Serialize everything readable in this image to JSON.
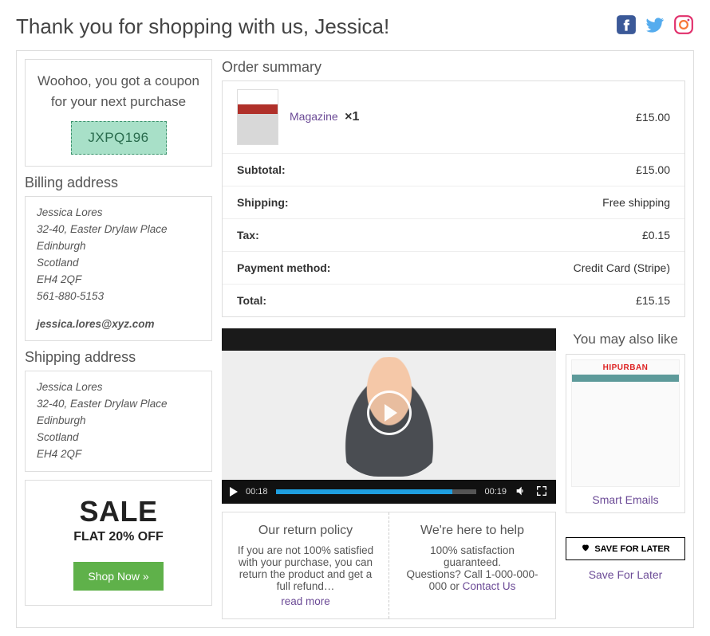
{
  "header": {
    "title": "Thank you for shopping with us, Jessica!"
  },
  "coupon": {
    "message": "Woohoo, you got a coupon for your next purchase",
    "code": "JXPQ196"
  },
  "billing": {
    "title": "Billing address",
    "name": "Jessica Lores",
    "street": "32-40, Easter Drylaw Place",
    "city": "Edinburgh",
    "region": "Scotland",
    "postcode": "EH4 2QF",
    "phone": "561-880-5153",
    "email": "jessica.lores@xyz.com"
  },
  "shipping": {
    "title": "Shipping address",
    "name": "Jessica Lores",
    "street": "32-40, Easter Drylaw Place",
    "city": "Edinburgh",
    "region": "Scotland",
    "postcode": "EH4 2QF"
  },
  "banner": {
    "headline": "SALE",
    "sub": "FLAT 20% OFF",
    "cta": "Shop Now »"
  },
  "order": {
    "title": "Order summary",
    "item": {
      "name": "Magazine",
      "qty": "×1",
      "price": "£15.00"
    },
    "rows": [
      {
        "label": "Subtotal:",
        "value": "£15.00"
      },
      {
        "label": "Shipping:",
        "value": "Free shipping"
      },
      {
        "label": "Tax:",
        "value": "£0.15"
      },
      {
        "label": "Payment method:",
        "value": "Credit Card (Stripe)"
      },
      {
        "label": "Total:",
        "value": "£15.15"
      }
    ]
  },
  "video": {
    "elapsed": "00:18",
    "total": "00:19"
  },
  "info": {
    "return": {
      "title": "Our return policy",
      "body": "If you are not 100% satisfied with your purchase, you can return the product and get a full refund…",
      "more": "read more"
    },
    "help": {
      "title": "We're here to help",
      "body1": "100% satisfaction guaranteed.",
      "body2": "Questions? Call 1-000-000-000 or ",
      "link": "Contact Us"
    }
  },
  "sidebar": {
    "title": "You may also like",
    "product1": "Smart Emails",
    "save_btn": "SAVE FOR LATER",
    "save_link": "Save For Later"
  }
}
